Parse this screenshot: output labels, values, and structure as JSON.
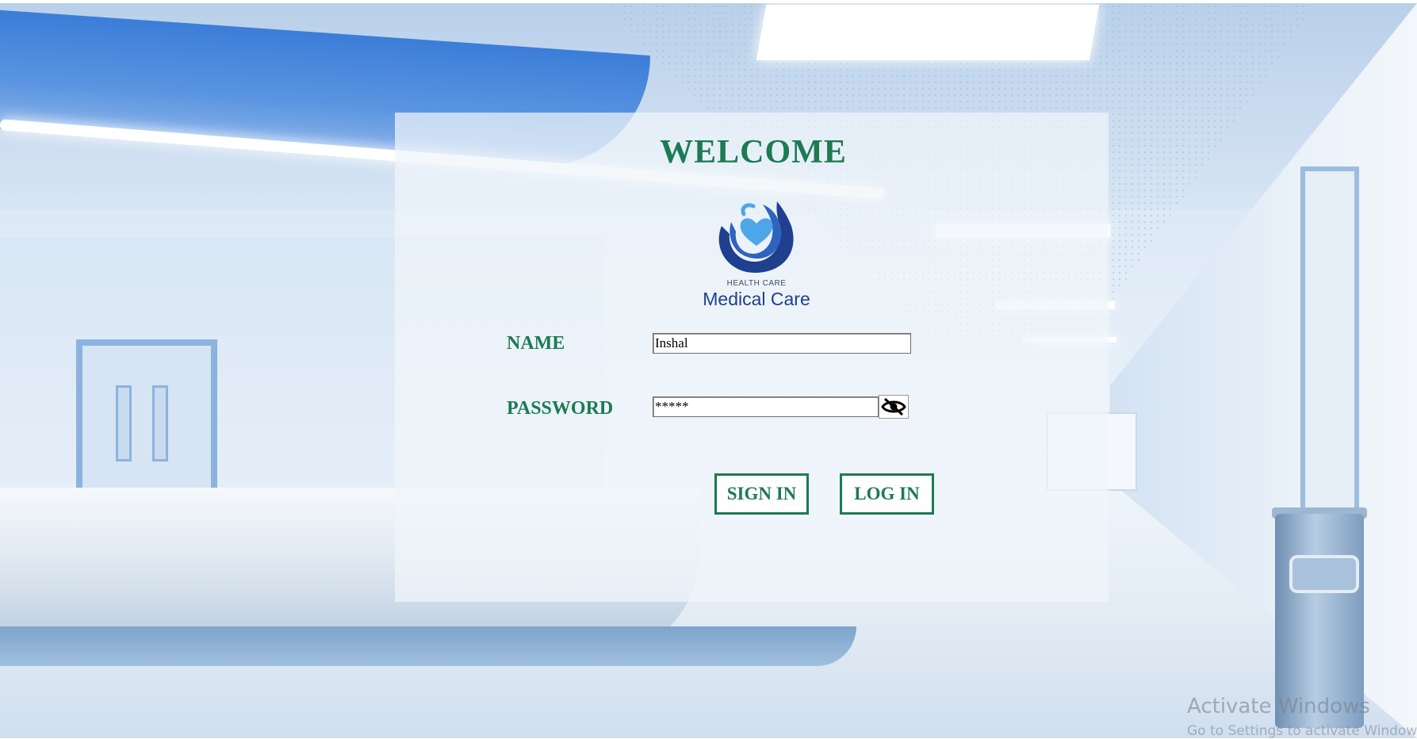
{
  "login": {
    "title": "WELCOME",
    "logo": {
      "subtitle": "HEALTH CARE",
      "name": "Medical Care"
    },
    "name_label": "NAME",
    "name_value": "Inshal",
    "password_label": "PASSWORD",
    "password_value": "*****",
    "sign_in_label": "SIGN IN",
    "log_in_label": "LOG IN"
  },
  "watermark": {
    "title": "Activate Windows",
    "subtitle": "Go to Settings to activate Windows."
  },
  "colors": {
    "accent": "#1d7a52",
    "logo_blue": "#1f3f8f"
  },
  "icons": {
    "password_toggle": "eye-slash-icon"
  }
}
